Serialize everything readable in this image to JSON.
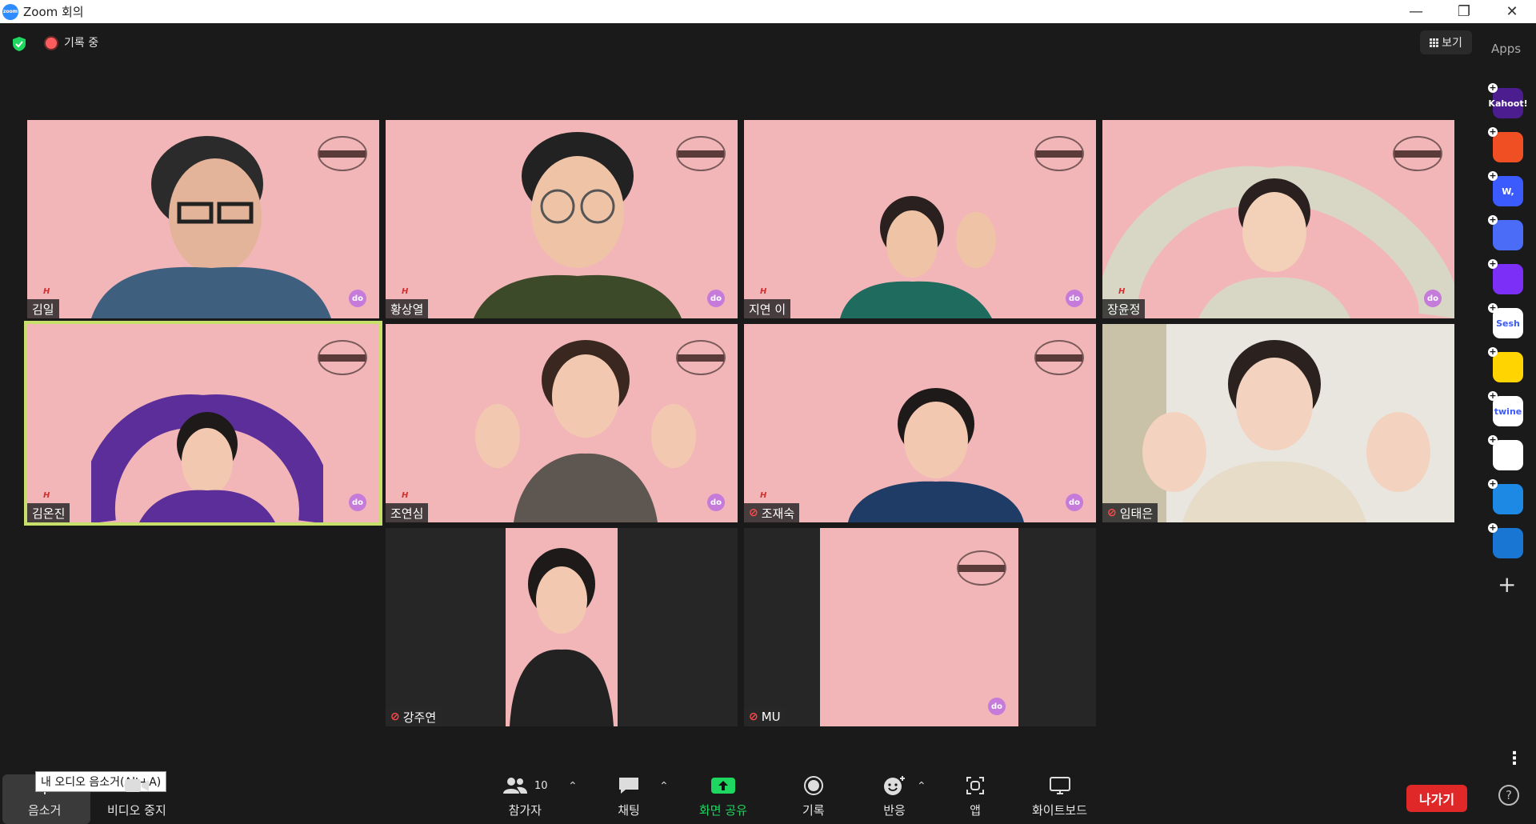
{
  "window": {
    "title": "Zoom 회의"
  },
  "meeting_bar": {
    "recording_label": "기록 중",
    "view_label": "보기",
    "apps_title": "Apps"
  },
  "apps": [
    {
      "label": "Kahoot!",
      "color": "#4c1d8f",
      "icon": "kahoot-icon"
    },
    {
      "label": "",
      "color": "#f04e23",
      "icon": "orange-app-icon"
    },
    {
      "label": "W,",
      "color": "#3b5bff",
      "icon": "wooclap-icon"
    },
    {
      "label": "",
      "color": "#4a6cf7",
      "icon": "blue-circle-app-icon"
    },
    {
      "label": "",
      "color": "#7b2ff7",
      "icon": "purple-stripes-app-icon"
    },
    {
      "label": "Sesh",
      "color": "#ffffff",
      "icon": "sesh-icon"
    },
    {
      "label": "",
      "color": "#ffd400",
      "icon": "emoji-app-icon"
    },
    {
      "label": "twine",
      "color": "#ffffff",
      "icon": "twine-icon"
    },
    {
      "label": "",
      "color": "#ffffff",
      "icon": "colorful-grid-app-icon"
    },
    {
      "label": "",
      "color": "#1e88e5",
      "icon": "sync-app-icon"
    },
    {
      "label": "",
      "color": "#1976d2",
      "icon": "blue-e-app-icon"
    }
  ],
  "participants": [
    {
      "name": "김일",
      "muted": false
    },
    {
      "name": "황상열",
      "muted": false
    },
    {
      "name": "지연 이",
      "muted": false
    },
    {
      "name": "장윤정",
      "muted": false
    },
    {
      "name": "김온진",
      "muted": false
    },
    {
      "name": "조연심",
      "muted": false
    },
    {
      "name": "조재숙",
      "muted": true
    },
    {
      "name": "임태은",
      "muted": true
    },
    {
      "name": "강주연",
      "muted": true
    },
    {
      "name": "MU",
      "muted": true
    }
  ],
  "badge_label": "do",
  "toolbar": {
    "mute_label": "음소거",
    "mute_tooltip": "내 오디오 음소거(Alt+A)",
    "video_label": "비디오 중지",
    "participants_label": "참가자",
    "participants_count": "10",
    "chat_label": "채팅",
    "share_label": "화면 공유",
    "record_label": "기록",
    "reactions_label": "반응",
    "apps_label": "앱",
    "whiteboard_label": "화이트보드",
    "leave_label": "나가기"
  },
  "colors": {
    "tile_background": "#f3b6b8",
    "active_speaker_border": "#c6e06a",
    "share_green": "#1ed760",
    "leave_red": "#e02828"
  }
}
